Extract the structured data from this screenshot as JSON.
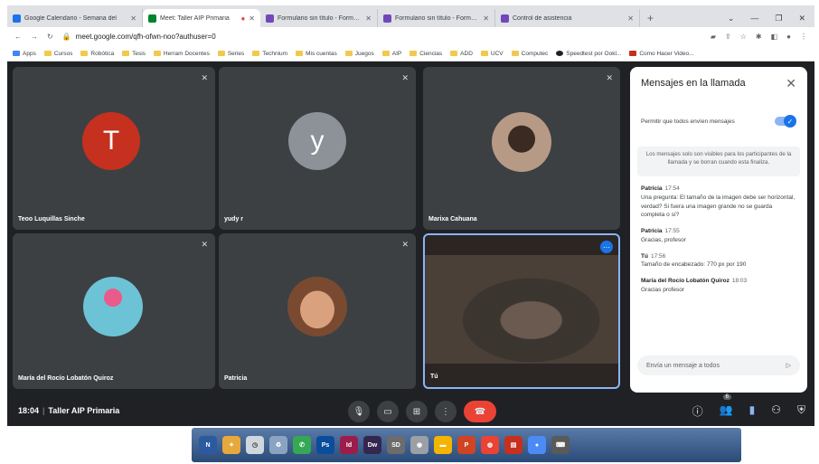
{
  "tabs": [
    {
      "title": "Google Calendario - Semana del",
      "icon": "calendar-icon",
      "color": "#1a73e8"
    },
    {
      "title": "Meet: Taller AIP Primaria",
      "icon": "meet-icon",
      "color": "#00832d",
      "active": true
    },
    {
      "title": "Formulario sin título - Formulario",
      "icon": "forms-icon",
      "color": "#7248b9"
    },
    {
      "title": "Formulario sin título - Formulario",
      "icon": "forms-icon",
      "color": "#7248b9"
    },
    {
      "title": "Control de asistencia",
      "icon": "forms-icon",
      "color": "#7248b9"
    }
  ],
  "toolbar": {
    "url": "meet.google.com/qfh-ofwn-noo?authuser=0"
  },
  "bookmarks": [
    "Apps",
    "Cursos",
    "Robótica",
    "Tesis",
    "Herram Docentes",
    "Series",
    "Technium",
    "Mis cuentas",
    "Juegos",
    "AIP",
    "Ciencias",
    "ADD",
    "UCV",
    "Computec",
    "Speedtest por Ookl...",
    "Como Hacer Video..."
  ],
  "participants": [
    {
      "name": "Teoo Luquillas Sinche",
      "initial": "T",
      "avatar_color": "#c5301f"
    },
    {
      "name": "yudy r",
      "initial": "y",
      "avatar_color": "#8d9299"
    },
    {
      "name": "Marixa Cahuana",
      "initial": "",
      "avatar_color": "#b79a86"
    },
    {
      "name": "María del Rocío Lobatón Quiroz",
      "initial": "",
      "avatar_color": "#6cc3d6"
    },
    {
      "name": "Patricia",
      "initial": "",
      "avatar_color": "#c48b6a"
    },
    {
      "name": "Tú",
      "initial": "",
      "avatar_color": "#3b3530"
    }
  ],
  "panel": {
    "title": "Mensajes en la llamada",
    "allow_label": "Permitir que todos envíen mensajes",
    "info": "Los mensajes solo son visibles para los participantes de la llamada y se borran cuando esta finaliza.",
    "compose_placeholder": "Envía un mensaje a todos",
    "messages": [
      {
        "sender": "Patricia",
        "time": "17:54",
        "text": "Una pregunta: El tamaño de la imagen debe ser horizontal, verdad? Si fuera una imagen grande no se guarda completa o sí?"
      },
      {
        "sender": "Patricia",
        "time": "17:55",
        "text": "Gracias, profesor"
      },
      {
        "sender": "Tú",
        "time": "17:56",
        "text": "Tamaño de encabezado: 770 px por 190"
      },
      {
        "sender": "María del Rocío Lobatón Quiroz",
        "time": "18:03",
        "text": "Gracias profesor"
      }
    ]
  },
  "bottombar": {
    "time": "18:04",
    "meeting": "Taller AIP Primaria",
    "people_count": "6"
  },
  "taskbar": [
    "ps-icon",
    "id-icon",
    "dw-icon",
    "folder-icon",
    "chrome-icon"
  ]
}
